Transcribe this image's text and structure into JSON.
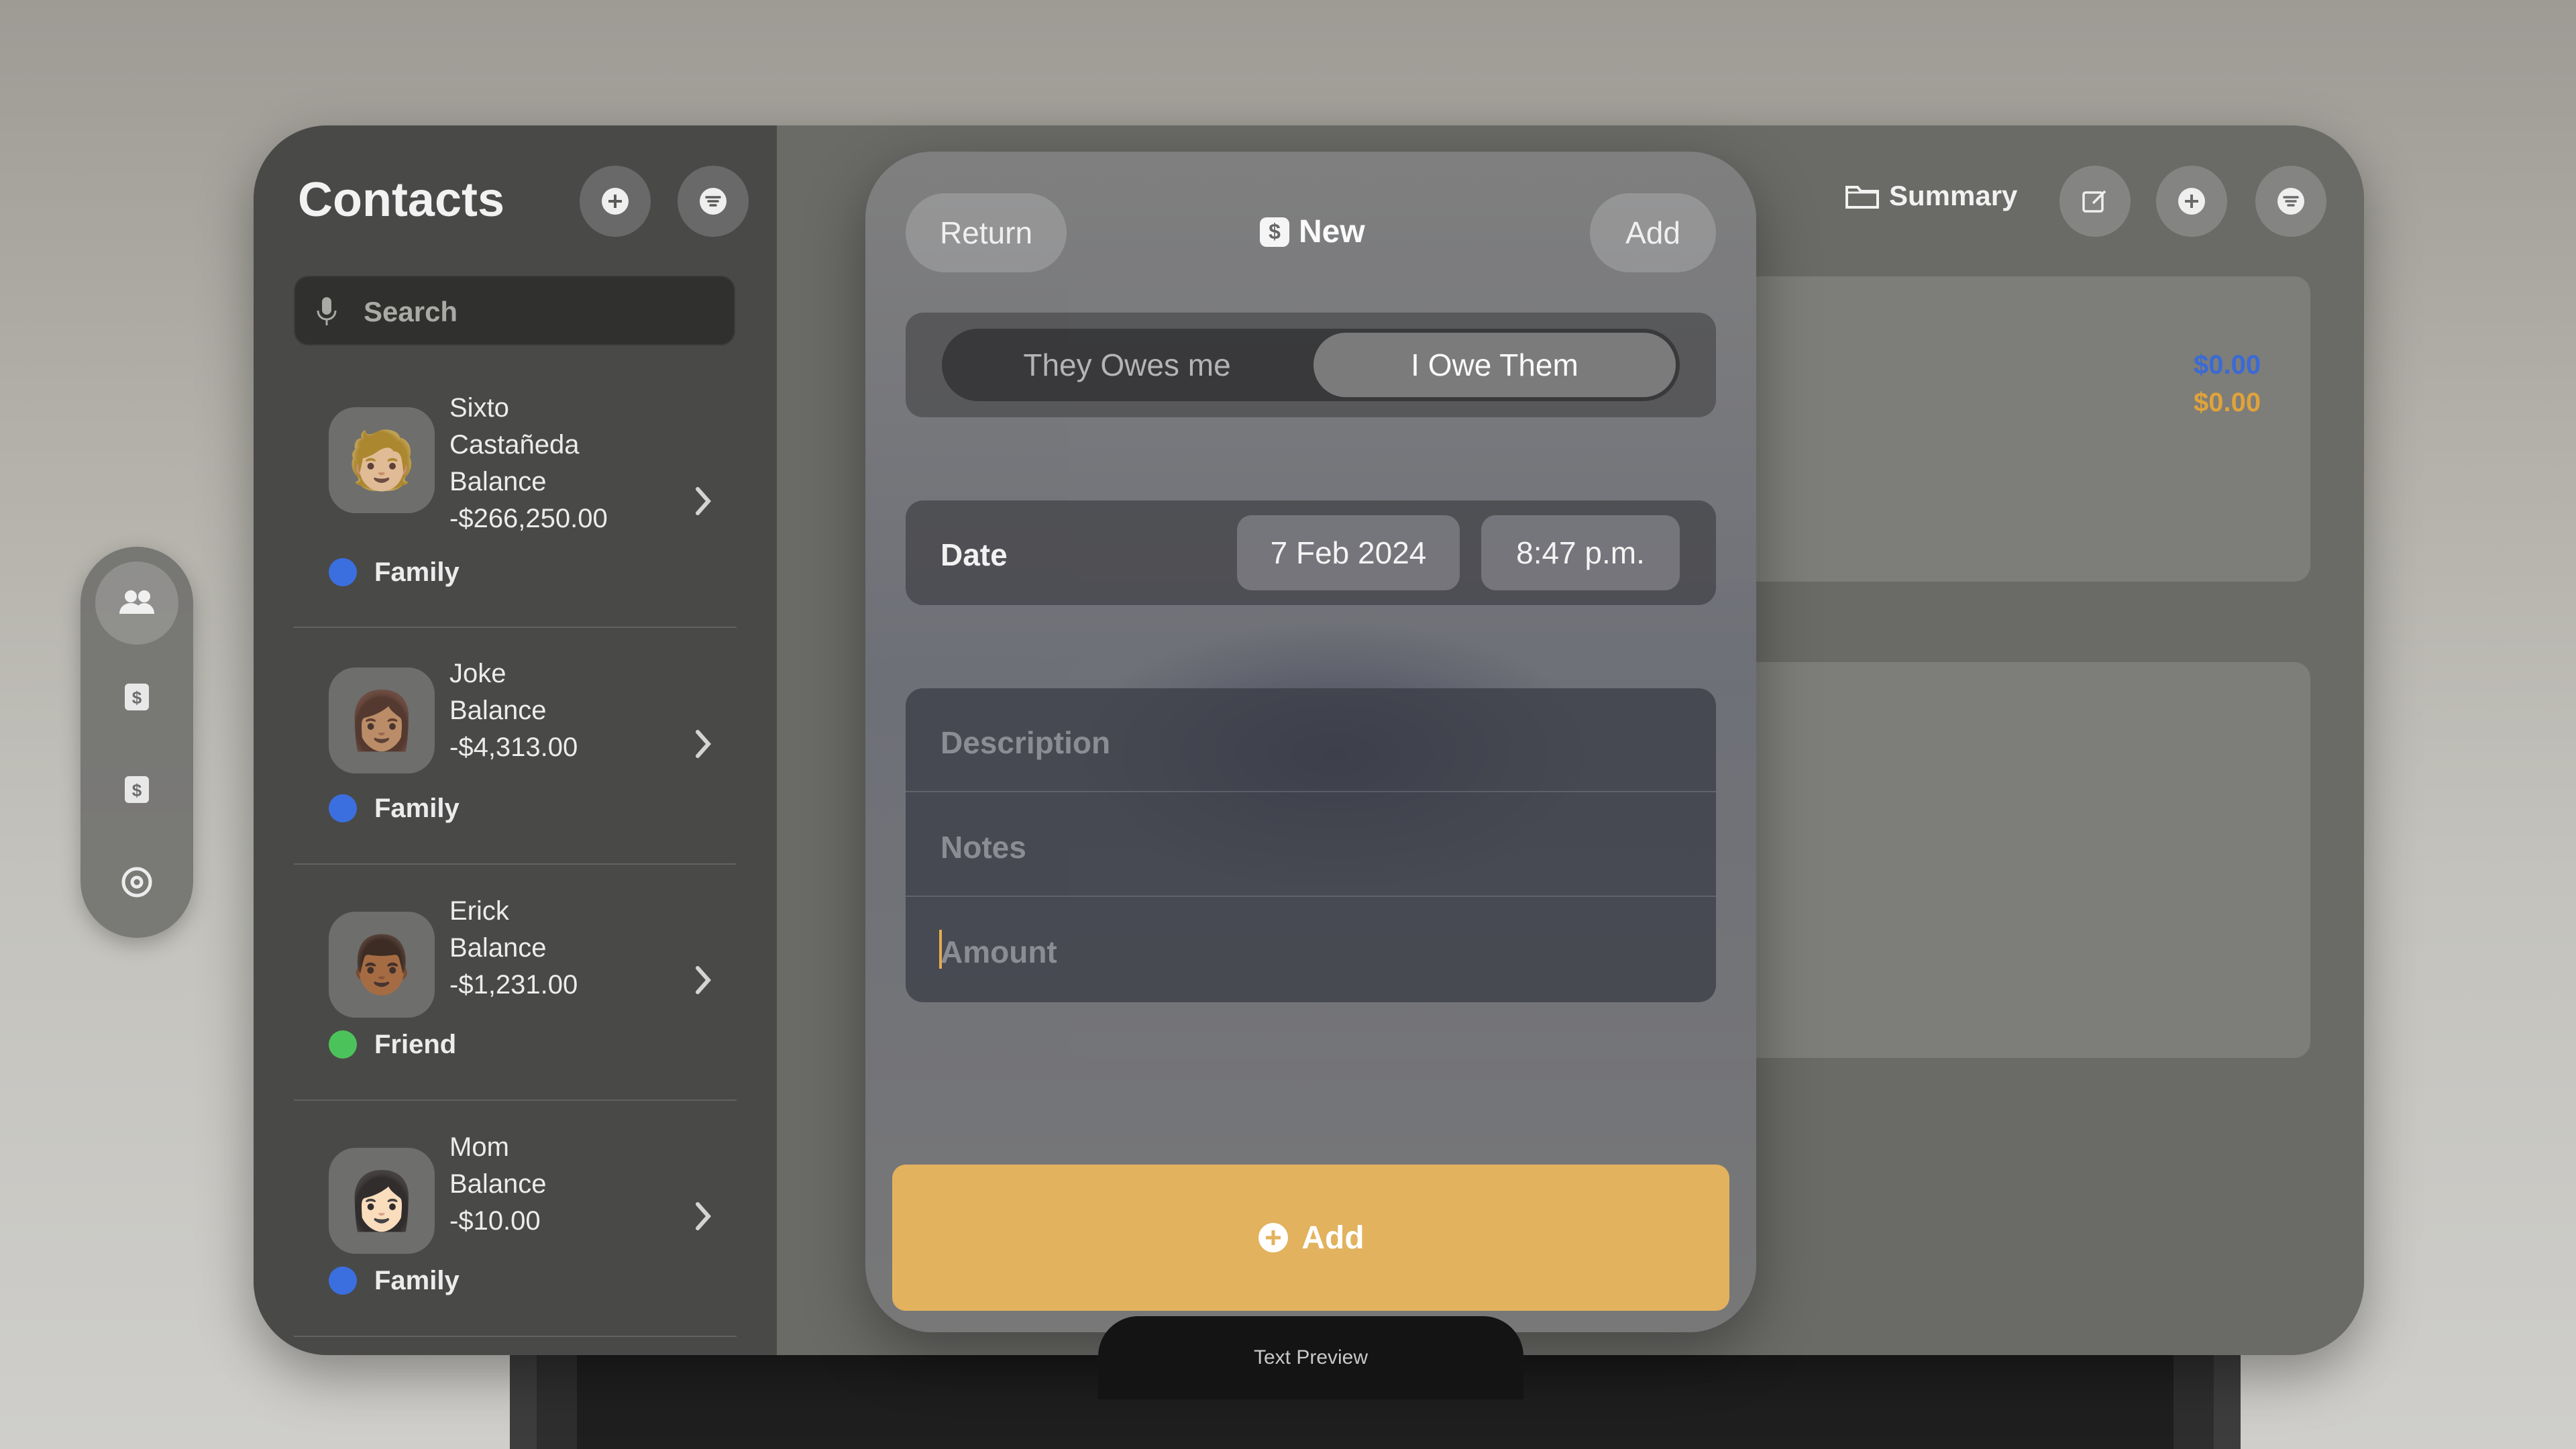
{
  "sidebar": {
    "items": [
      {
        "icon": "people-icon",
        "active": true
      },
      {
        "icon": "dollar-doc-icon",
        "active": false
      },
      {
        "icon": "dollar-doc-icon",
        "active": false
      },
      {
        "icon": "gear-icon",
        "active": false
      }
    ]
  },
  "contacts": {
    "title": "Contacts",
    "search_placeholder": "Search",
    "items": [
      {
        "name_line1": "Sixto",
        "name_line2": "Castañeda",
        "balance_label": "Balance",
        "balance": "-$266,250.00",
        "tag": "Family",
        "tag_color": "#3b6fe0",
        "avatar": "🧑🏼"
      },
      {
        "name_line1": "Joke",
        "balance_label": "Balance",
        "balance": "-$4,313.00",
        "tag": "Family",
        "tag_color": "#3b6fe0",
        "avatar": "👩🏽"
      },
      {
        "name_line1": "Erick",
        "balance_label": "Balance",
        "balance": "-$1,231.00",
        "tag": "Friend",
        "tag_color": "#4cc35a",
        "avatar": "👨🏾"
      },
      {
        "name_line1": "Mom",
        "balance_label": "Balance",
        "balance": "-$10.00",
        "tag": "Family",
        "tag_color": "#3b6fe0",
        "avatar": "👩🏻"
      }
    ]
  },
  "main": {
    "summary_label": "Summary",
    "amount_blue": "$0.00",
    "amount_orange": "$0.00"
  },
  "modal": {
    "return_label": "Return",
    "title": "New",
    "add_label": "Add",
    "segment": {
      "options": [
        "They Owes me",
        "I Owe Them"
      ],
      "selected": "I Owe Them"
    },
    "date_label": "Date",
    "date_value": "7 Feb 2024",
    "time_value": "8:47 p.m.",
    "description_placeholder": "Description",
    "notes_placeholder": "Notes",
    "amount_placeholder": "Amount",
    "big_add_label": "Add"
  },
  "text_preview": "Text Preview",
  "colors": {
    "accent": "#e2b25e",
    "family": "#3b6fe0",
    "friend": "#4cc35a"
  }
}
